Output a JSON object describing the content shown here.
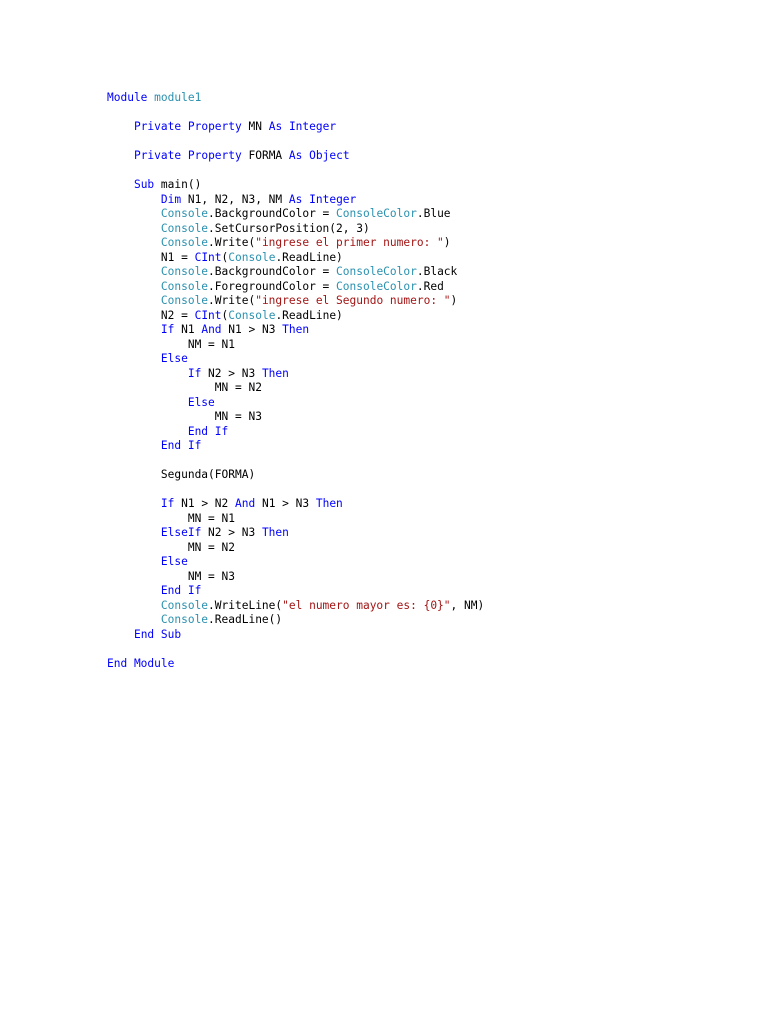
{
  "colors": {
    "keyword": "#0000ff",
    "type": "#2b91af",
    "string": "#a31515",
    "plain": "#000000",
    "background": "#ffffff"
  },
  "code": {
    "lines": [
      {
        "indent": 0,
        "tokens": [
          {
            "t": "kw",
            "v": "Module"
          },
          {
            "t": "plain",
            "v": " "
          },
          {
            "t": "type",
            "v": "module1"
          }
        ]
      },
      {
        "indent": 0,
        "tokens": []
      },
      {
        "indent": 1,
        "tokens": [
          {
            "t": "kw",
            "v": "Private"
          },
          {
            "t": "plain",
            "v": " "
          },
          {
            "t": "kw",
            "v": "Property"
          },
          {
            "t": "plain",
            "v": " MN "
          },
          {
            "t": "kw",
            "v": "As"
          },
          {
            "t": "plain",
            "v": " "
          },
          {
            "t": "kw",
            "v": "Integer"
          }
        ]
      },
      {
        "indent": 0,
        "tokens": []
      },
      {
        "indent": 1,
        "tokens": [
          {
            "t": "kw",
            "v": "Private"
          },
          {
            "t": "plain",
            "v": " "
          },
          {
            "t": "kw",
            "v": "Property"
          },
          {
            "t": "plain",
            "v": " FORMA "
          },
          {
            "t": "kw",
            "v": "As"
          },
          {
            "t": "plain",
            "v": " "
          },
          {
            "t": "kw",
            "v": "Object"
          }
        ]
      },
      {
        "indent": 0,
        "tokens": []
      },
      {
        "indent": 1,
        "tokens": [
          {
            "t": "kw",
            "v": "Sub"
          },
          {
            "t": "plain",
            "v": " main()"
          }
        ]
      },
      {
        "indent": 2,
        "tokens": [
          {
            "t": "kw",
            "v": "Dim"
          },
          {
            "t": "plain",
            "v": " N1, N2, N3, NM "
          },
          {
            "t": "kw",
            "v": "As"
          },
          {
            "t": "plain",
            "v": " "
          },
          {
            "t": "kw",
            "v": "Integer"
          }
        ]
      },
      {
        "indent": 2,
        "tokens": [
          {
            "t": "type",
            "v": "Console"
          },
          {
            "t": "plain",
            "v": ".BackgroundColor = "
          },
          {
            "t": "type",
            "v": "ConsoleColor"
          },
          {
            "t": "plain",
            "v": ".Blue"
          }
        ]
      },
      {
        "indent": 2,
        "tokens": [
          {
            "t": "type",
            "v": "Console"
          },
          {
            "t": "plain",
            "v": ".SetCursorPosition(2, 3)"
          }
        ]
      },
      {
        "indent": 2,
        "tokens": [
          {
            "t": "type",
            "v": "Console"
          },
          {
            "t": "plain",
            "v": ".Write("
          },
          {
            "t": "str",
            "v": "\"ingrese el primer numero: \""
          },
          {
            "t": "plain",
            "v": ")"
          }
        ]
      },
      {
        "indent": 2,
        "tokens": [
          {
            "t": "plain",
            "v": "N1 = "
          },
          {
            "t": "kw",
            "v": "CInt"
          },
          {
            "t": "plain",
            "v": "("
          },
          {
            "t": "type",
            "v": "Console"
          },
          {
            "t": "plain",
            "v": ".ReadLine)"
          }
        ]
      },
      {
        "indent": 2,
        "tokens": [
          {
            "t": "type",
            "v": "Console"
          },
          {
            "t": "plain",
            "v": ".BackgroundColor = "
          },
          {
            "t": "type",
            "v": "ConsoleColor"
          },
          {
            "t": "plain",
            "v": ".Black"
          }
        ]
      },
      {
        "indent": 2,
        "tokens": [
          {
            "t": "type",
            "v": "Console"
          },
          {
            "t": "plain",
            "v": ".ForegroundColor = "
          },
          {
            "t": "type",
            "v": "ConsoleColor"
          },
          {
            "t": "plain",
            "v": ".Red"
          }
        ]
      },
      {
        "indent": 2,
        "tokens": [
          {
            "t": "type",
            "v": "Console"
          },
          {
            "t": "plain",
            "v": ".Write("
          },
          {
            "t": "str",
            "v": "\"ingrese el Segundo numero: \""
          },
          {
            "t": "plain",
            "v": ")"
          }
        ]
      },
      {
        "indent": 2,
        "tokens": [
          {
            "t": "plain",
            "v": "N2 = "
          },
          {
            "t": "kw",
            "v": "CInt"
          },
          {
            "t": "plain",
            "v": "("
          },
          {
            "t": "type",
            "v": "Console"
          },
          {
            "t": "plain",
            "v": ".ReadLine)"
          }
        ]
      },
      {
        "indent": 2,
        "tokens": [
          {
            "t": "kw",
            "v": "If"
          },
          {
            "t": "plain",
            "v": " N1 "
          },
          {
            "t": "kw",
            "v": "And"
          },
          {
            "t": "plain",
            "v": " N1 > N3 "
          },
          {
            "t": "kw",
            "v": "Then"
          }
        ]
      },
      {
        "indent": 3,
        "tokens": [
          {
            "t": "plain",
            "v": "NM = N1"
          }
        ]
      },
      {
        "indent": 2,
        "tokens": [
          {
            "t": "kw",
            "v": "Else"
          }
        ]
      },
      {
        "indent": 3,
        "tokens": [
          {
            "t": "kw",
            "v": "If"
          },
          {
            "t": "plain",
            "v": " N2 > N3 "
          },
          {
            "t": "kw",
            "v": "Then"
          }
        ]
      },
      {
        "indent": 4,
        "tokens": [
          {
            "t": "plain",
            "v": "MN = N2"
          }
        ]
      },
      {
        "indent": 3,
        "tokens": [
          {
            "t": "kw",
            "v": "Else"
          }
        ]
      },
      {
        "indent": 4,
        "tokens": [
          {
            "t": "plain",
            "v": "MN = N3"
          }
        ]
      },
      {
        "indent": 3,
        "tokens": [
          {
            "t": "kw",
            "v": "End If"
          }
        ]
      },
      {
        "indent": 2,
        "tokens": [
          {
            "t": "kw",
            "v": "End If"
          }
        ]
      },
      {
        "indent": 0,
        "tokens": []
      },
      {
        "indent": 2,
        "tokens": [
          {
            "t": "plain",
            "v": "Segunda(FORMA)"
          }
        ]
      },
      {
        "indent": 0,
        "tokens": []
      },
      {
        "indent": 2,
        "tokens": [
          {
            "t": "kw",
            "v": "If"
          },
          {
            "t": "plain",
            "v": " N1 > N2 "
          },
          {
            "t": "kw",
            "v": "And"
          },
          {
            "t": "plain",
            "v": " N1 > N3 "
          },
          {
            "t": "kw",
            "v": "Then"
          }
        ]
      },
      {
        "indent": 3,
        "tokens": [
          {
            "t": "plain",
            "v": "MN = N1"
          }
        ]
      },
      {
        "indent": 2,
        "tokens": [
          {
            "t": "kw",
            "v": "ElseIf"
          },
          {
            "t": "plain",
            "v": " N2 > N3 "
          },
          {
            "t": "kw",
            "v": "Then"
          }
        ]
      },
      {
        "indent": 3,
        "tokens": [
          {
            "t": "plain",
            "v": "MN = N2"
          }
        ]
      },
      {
        "indent": 2,
        "tokens": [
          {
            "t": "kw",
            "v": "Else"
          }
        ]
      },
      {
        "indent": 3,
        "tokens": [
          {
            "t": "plain",
            "v": "NM = N3"
          }
        ]
      },
      {
        "indent": 2,
        "tokens": [
          {
            "t": "kw",
            "v": "End If"
          }
        ]
      },
      {
        "indent": 2,
        "tokens": [
          {
            "t": "type",
            "v": "Console"
          },
          {
            "t": "plain",
            "v": ".WriteLine("
          },
          {
            "t": "str",
            "v": "\"el numero mayor es: {0}\""
          },
          {
            "t": "plain",
            "v": ", NM)"
          }
        ]
      },
      {
        "indent": 2,
        "tokens": [
          {
            "t": "type",
            "v": "Console"
          },
          {
            "t": "plain",
            "v": ".ReadLine()"
          }
        ]
      },
      {
        "indent": 1,
        "tokens": [
          {
            "t": "kw",
            "v": "End Sub"
          }
        ]
      },
      {
        "indent": 0,
        "tokens": []
      },
      {
        "indent": 0,
        "tokens": [
          {
            "t": "kw",
            "v": "End Module"
          }
        ]
      }
    ]
  }
}
